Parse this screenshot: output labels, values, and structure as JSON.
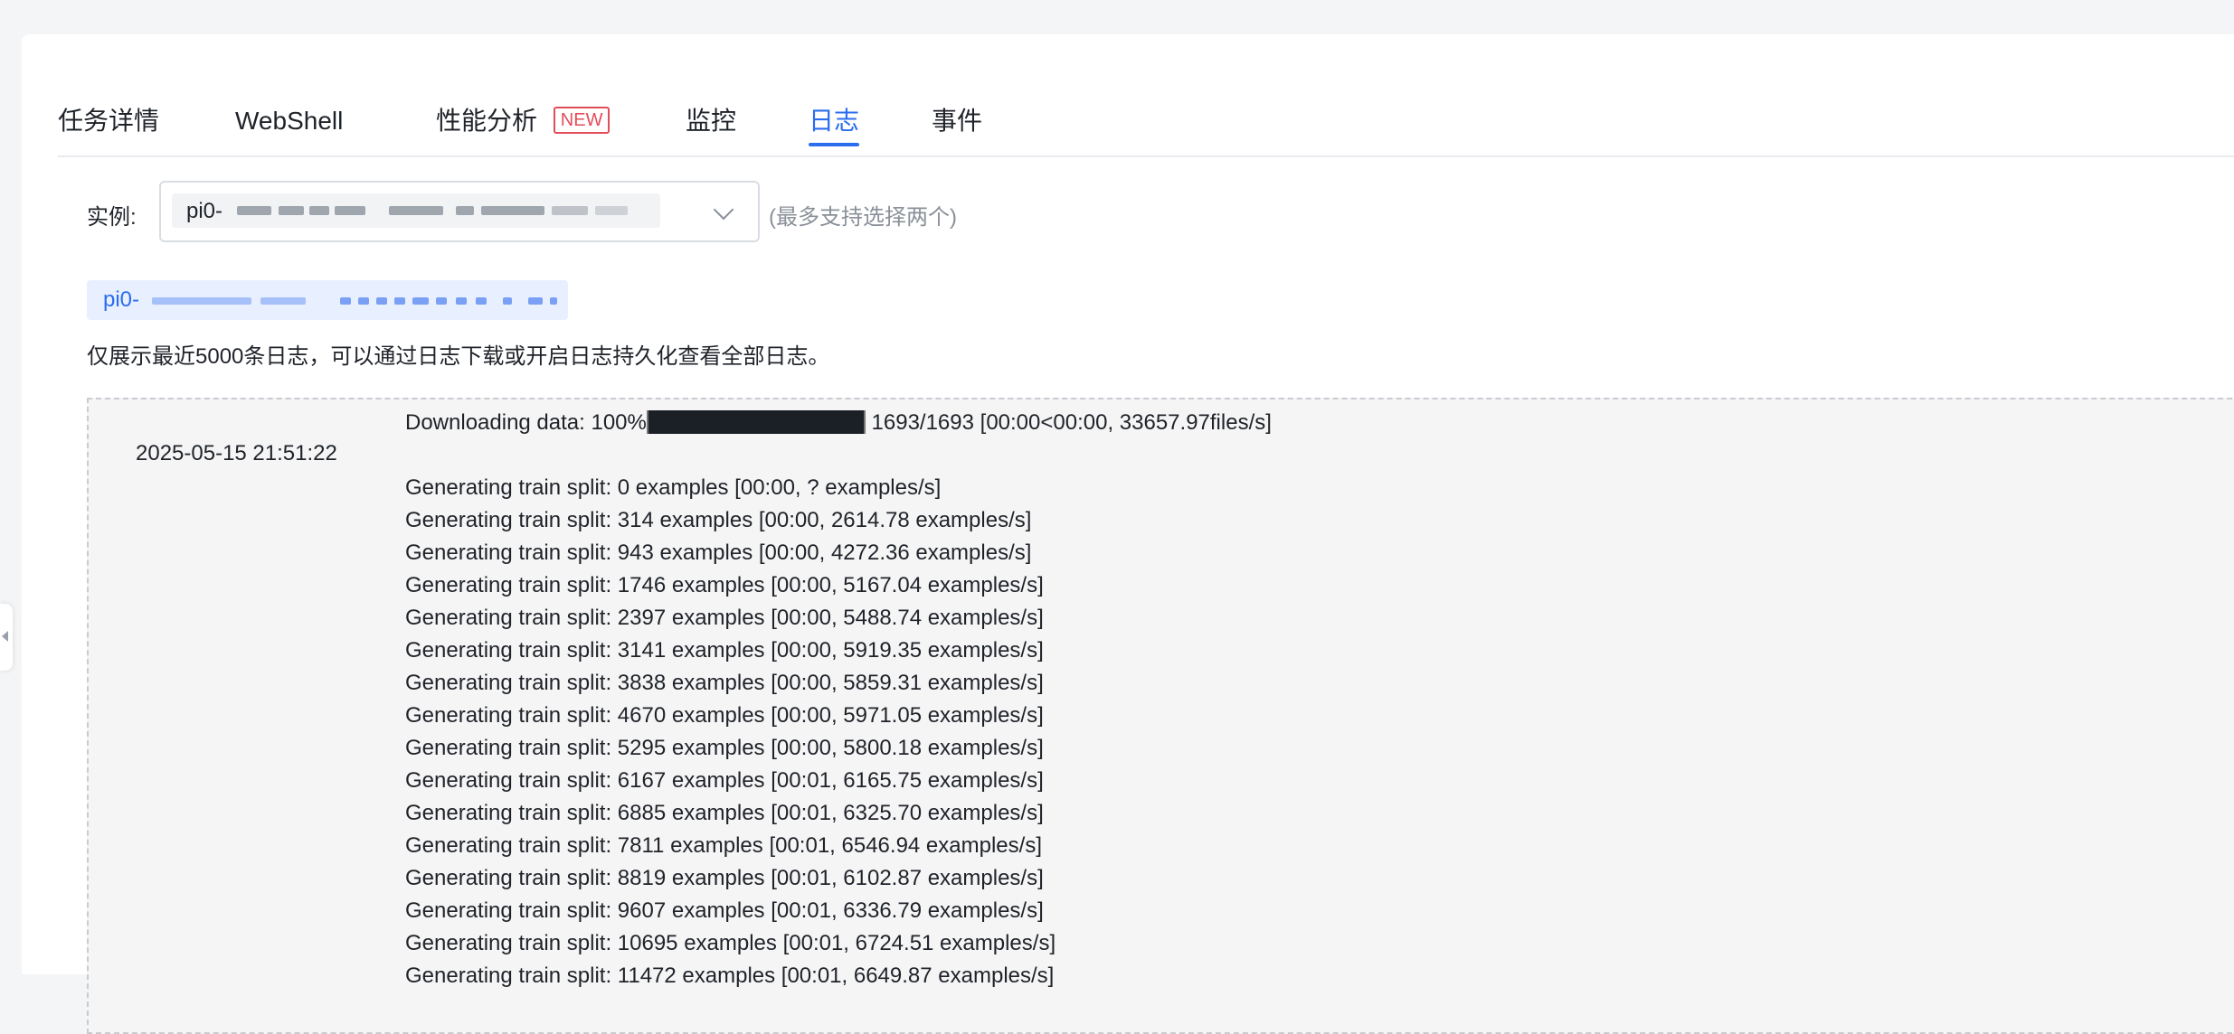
{
  "tabs": [
    {
      "label": "任务详情",
      "active": false
    },
    {
      "label": "WebShell",
      "active": false
    },
    {
      "label": "性能分析",
      "badge": "NEW",
      "active": false
    },
    {
      "label": "监控",
      "active": false
    },
    {
      "label": "日志",
      "active": true
    },
    {
      "label": "事件",
      "active": false
    }
  ],
  "instance": {
    "label": "实例:",
    "selected_prefix": "pi0-",
    "hint": "(最多支持选择两个)"
  },
  "chip": {
    "prefix": "pi0-"
  },
  "notice": "仅展示最近5000条日志，可以通过日志下载或开启日志持久化查看全部日志。",
  "log": {
    "timestamp": "2025-05-15 21:51:22",
    "download_prefix": "Downloading data: 100%",
    "download_suffix": " 1693/1693 [00:00<00:00, 33657.97files/s]",
    "download_progress": 1.0,
    "lines": [
      "Generating train split: 0 examples [00:00, ? examples/s]",
      "Generating train split: 314 examples [00:00, 2614.78 examples/s]",
      "Generating train split: 943 examples [00:00, 4272.36 examples/s]",
      "Generating train split: 1746 examples [00:00, 5167.04 examples/s]",
      "Generating train split: 2397 examples [00:00, 5488.74 examples/s]",
      "Generating train split: 3141 examples [00:00, 5919.35 examples/s]",
      "Generating train split: 3838 examples [00:00, 5859.31 examples/s]",
      "Generating train split: 4670 examples [00:00, 5971.05 examples/s]",
      "Generating train split: 5295 examples [00:00, 5800.18 examples/s]",
      "Generating train split: 6167 examples [00:01, 6165.75 examples/s]",
      "Generating train split: 6885 examples [00:01, 6325.70 examples/s]",
      "Generating train split: 7811 examples [00:01, 6546.94 examples/s]",
      "Generating train split: 8819 examples [00:01, 6102.87 examples/s]",
      "Generating train split: 9607 examples [00:01, 6336.79 examples/s]",
      "Generating train split: 10695 examples [00:01, 6724.51 examples/s]",
      "Generating train split: 11472 examples [00:01, 6649.87 examples/s]"
    ]
  },
  "colors": {
    "accent": "#2b6def",
    "badge": "#e34d59",
    "log_bg": "#f5f5f5"
  }
}
